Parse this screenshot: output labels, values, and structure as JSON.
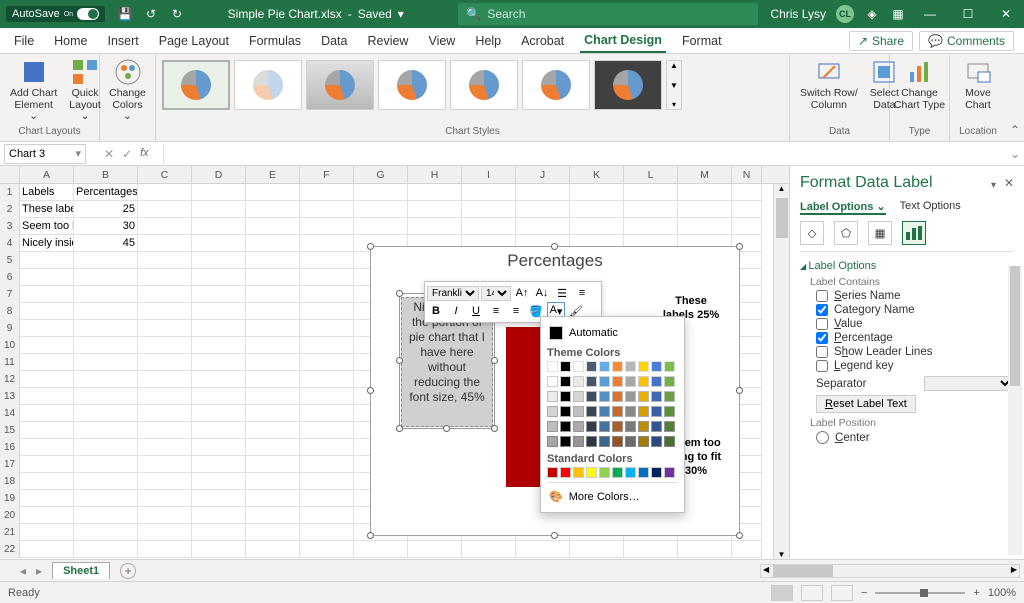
{
  "titlebar": {
    "autosave": "AutoSave",
    "autosave_state": "On",
    "filename": "Simple Pie Chart.xlsx",
    "saved": "Saved",
    "search_placeholder": "Search",
    "user": "Chris Lysy",
    "user_initials": "CL"
  },
  "tabs": {
    "items": [
      "File",
      "Home",
      "Insert",
      "Page Layout",
      "Formulas",
      "Data",
      "Review",
      "View",
      "Help",
      "Acrobat",
      "Chart Design",
      "Format"
    ],
    "active": "Chart Design",
    "share": "Share",
    "comments": "Comments"
  },
  "ribbon": {
    "chart_layouts_label": "Chart Layouts",
    "add_element": "Add Chart\nElement",
    "quick_layout": "Quick\nLayout",
    "change_colors": "Change\nColors",
    "chart_styles_label": "Chart Styles",
    "switch_rowcol": "Switch Row/\nColumn",
    "select_data": "Select\nData",
    "data_label": "Data",
    "change_type": "Change\nChart Type",
    "type_label": "Type",
    "move_chart": "Move\nChart",
    "location_label": "Location"
  },
  "namebox": "Chart 3",
  "columns": [
    "A",
    "B",
    "C",
    "D",
    "E",
    "F",
    "G",
    "H",
    "I",
    "J",
    "K",
    "L",
    "M",
    "N"
  ],
  "rows": [
    "1",
    "2",
    "3",
    "4",
    "5",
    "6",
    "7",
    "8",
    "9",
    "10",
    "11",
    "12",
    "13",
    "14",
    "15",
    "16",
    "17",
    "18",
    "19",
    "20",
    "21",
    "22"
  ],
  "cells": {
    "A1": "Labels",
    "B1": "Percentages",
    "A2": "These labe",
    "B2": "25",
    "A3": "Seem too l",
    "B3": "30",
    "A4": "Nicely insid",
    "B4": "45"
  },
  "chart": {
    "title": "Percentages",
    "label_sel": "Nicely inside the portion of pie chart that I have here without reducing the font size, 45%",
    "label_a": "These\nlabels\n25%",
    "label_b": "Seem too\nlong to fit\n30%"
  },
  "minitoolbar": {
    "font": "Franklin Gothic",
    "size": "14"
  },
  "colorpicker": {
    "automatic": "Automatic",
    "theme_hdr": "Theme Colors",
    "std_hdr": "Standard Colors",
    "more": "More Colors…"
  },
  "fpane": {
    "title": "Format Data Label",
    "tab_a": "Label Options",
    "tab_b": "Text Options",
    "section": "Label Options",
    "contains": "Label Contains",
    "series": "Series Name",
    "category": "Category Name",
    "value": "Value",
    "percentage": "Percentage",
    "leader": "Show Leader Lines",
    "legendkey": "Legend key",
    "separator": "Separator",
    "reset": "Reset Label Text",
    "position": "Label Position",
    "center": "Center"
  },
  "sheettabs": {
    "name": "Sheet1"
  },
  "status": {
    "ready": "Ready",
    "zoom": "100%"
  },
  "chart_data": {
    "type": "pie",
    "title": "Percentages",
    "categories": [
      "These labels",
      "Seem too long to fit",
      "Nicely inside the portion of pie chart that I have here without reducing the font size"
    ],
    "values": [
      25,
      30,
      45
    ],
    "data_labels": {
      "show_category": true,
      "show_percentage": true
    }
  }
}
